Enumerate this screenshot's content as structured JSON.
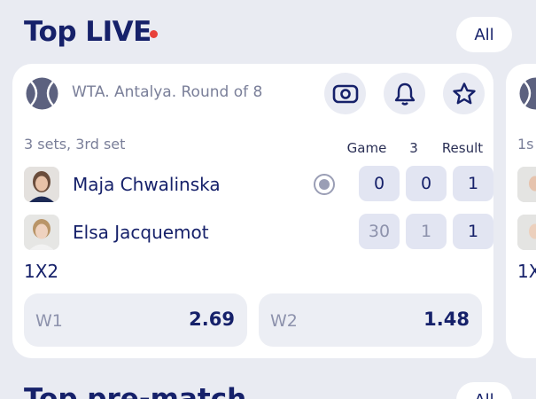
{
  "header": {
    "title": "Top LIVE",
    "all_label": "All",
    "live_dot_color": "#e8413a"
  },
  "match": {
    "sport_icon": "tennis-ball-icon",
    "league": "WTA. Antalya. Round of 8",
    "actions": [
      "scoreboard-icon",
      "bell-icon",
      "star-icon"
    ],
    "sets_info": "3 sets, 3rd set",
    "columns": [
      "Game",
      "3",
      "Result"
    ],
    "players": [
      {
        "name": "Maja Chwalinska",
        "serving": true,
        "game": "0",
        "set3": "0",
        "result": "1"
      },
      {
        "name": "Elsa Jacquemot",
        "serving": false,
        "game": "30",
        "set3": "1",
        "result": "1"
      }
    ],
    "market": "1X2",
    "odds": [
      {
        "label": "W1",
        "value": "2.69"
      },
      {
        "label": "W2",
        "value": "1.48"
      }
    ]
  },
  "next_card": {
    "sets_info_partial": "1s",
    "market_partial": "1X"
  },
  "section2": {
    "title": "Top pre-match",
    "all_label": "All"
  }
}
